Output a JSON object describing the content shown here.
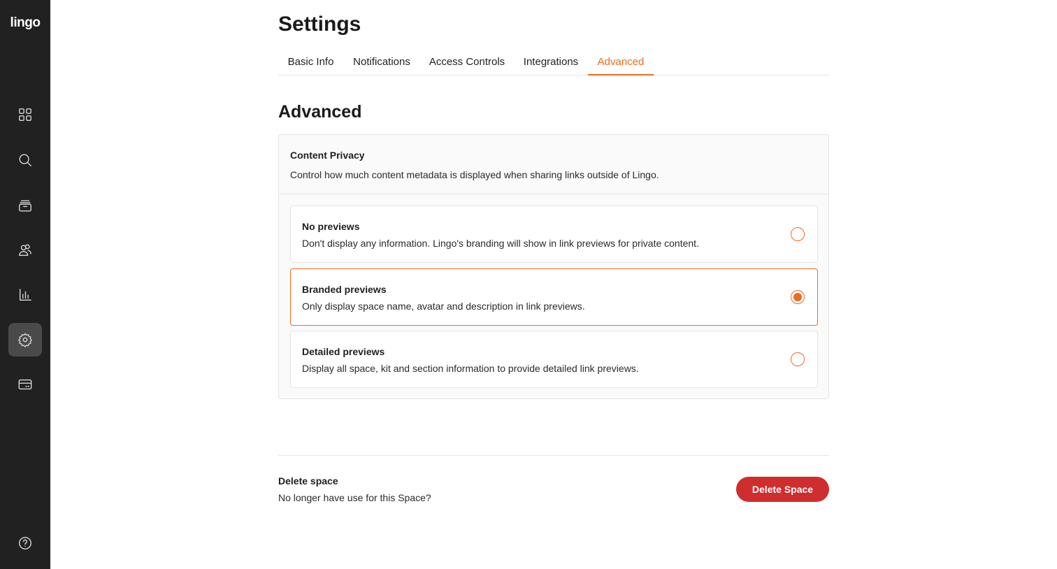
{
  "app": {
    "logo_text": "lingo"
  },
  "sidebar": {
    "items": [
      {
        "icon": "grid-icon",
        "label": "Dashboard",
        "active": false
      },
      {
        "icon": "search-icon",
        "label": "Search",
        "active": false
      },
      {
        "icon": "archive-icon",
        "label": "Library",
        "active": false
      },
      {
        "icon": "users-icon",
        "label": "Members",
        "active": false
      },
      {
        "icon": "chart-icon",
        "label": "Insights",
        "active": false
      },
      {
        "icon": "gear-icon",
        "label": "Settings",
        "active": true
      },
      {
        "icon": "billing-card-icon",
        "label": "Billing",
        "active": false
      }
    ],
    "help_icon": "help-circle-icon"
  },
  "page": {
    "title": "Settings"
  },
  "tabs": [
    {
      "label": "Basic Info",
      "active": false
    },
    {
      "label": "Notifications",
      "active": false
    },
    {
      "label": "Access Controls",
      "active": false
    },
    {
      "label": "Integrations",
      "active": false
    },
    {
      "label": "Advanced",
      "active": true
    }
  ],
  "advanced": {
    "title": "Advanced",
    "privacy": {
      "title": "Content Privacy",
      "description": "Control how much content metadata is displayed when sharing links outside of Lingo.",
      "options": [
        {
          "title": "No previews",
          "description": "Don't display any information. Lingo's branding will show in link previews for private content.",
          "selected": false
        },
        {
          "title": "Branded previews",
          "description": "Only display space name, avatar and description in link previews.",
          "selected": true
        },
        {
          "title": "Detailed previews",
          "description": "Display all space, kit and section information to provide detailed link previews.",
          "selected": false
        }
      ]
    }
  },
  "delete_space": {
    "title": "Delete space",
    "description": "No longer have use for this Space?",
    "button_label": "Delete Space"
  },
  "colors": {
    "accent": "#f06a1f",
    "danger": "#cf2e2e",
    "sidebar_bg": "#212121"
  }
}
